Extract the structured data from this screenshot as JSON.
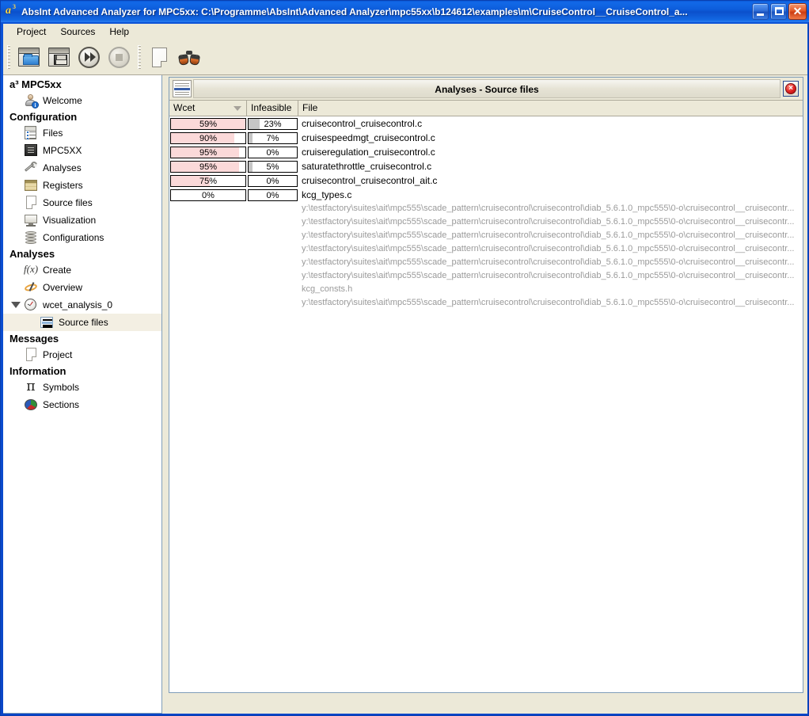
{
  "window": {
    "title": "AbsInt Advanced Analyzer for MPC5xx: C:\\Programme\\AbsInt\\Advanced Analyzer\\mpc55xx\\b124612\\examples\\m\\CruiseControl__CruiseControl_a...",
    "logo_letter": "a",
    "logo_sup": "3",
    "minimize_label": "",
    "maximize_label": "",
    "close_label": "✕"
  },
  "menubar": {
    "items": [
      {
        "label": "Project",
        "name": "menu-project"
      },
      {
        "label": "Sources",
        "name": "menu-sources"
      },
      {
        "label": "Help",
        "name": "menu-help"
      }
    ]
  },
  "toolbar": {
    "buttons": [
      {
        "name": "open-project-button",
        "icon": "open-project-icon",
        "tooltip": "Open project"
      },
      {
        "name": "save-project-button",
        "icon": "save-project-icon",
        "tooltip": "Save project"
      },
      {
        "name": "run-analysis-button",
        "icon": "fast-forward-icon",
        "tooltip": "Run analysis"
      },
      {
        "name": "stop-analysis-button",
        "icon": "stop-icon",
        "tooltip": "Stop analysis"
      },
      {
        "name": "new-file-button",
        "icon": "page-icon",
        "tooltip": "New file"
      },
      {
        "name": "find-button",
        "icon": "binoculars-icon",
        "tooltip": "Find"
      }
    ]
  },
  "sidebar": {
    "root_label": "a³ MPC5xx",
    "sections": [
      {
        "header": null,
        "items": [
          {
            "label": "Welcome",
            "icon": "user-info-icon",
            "name": "sidebar-item-welcome",
            "selected": false
          }
        ]
      },
      {
        "header": "Configuration",
        "items": [
          {
            "label": "Files",
            "icon": "files-icon",
            "name": "sidebar-item-files",
            "selected": false
          },
          {
            "label": "MPC5XX",
            "icon": "chip-icon",
            "name": "sidebar-item-mpc5xx",
            "selected": false
          },
          {
            "label": "Analyses",
            "icon": "wrench-icon",
            "name": "sidebar-item-analyses-config",
            "selected": false
          },
          {
            "label": "Registers",
            "icon": "registers-icon",
            "name": "sidebar-item-registers",
            "selected": false
          },
          {
            "label": "Source files",
            "icon": "document-icon",
            "name": "sidebar-item-source-files-config",
            "selected": false
          },
          {
            "label": "Visualization",
            "icon": "monitor-icon",
            "name": "sidebar-item-visualization",
            "selected": false
          },
          {
            "label": "Configurations",
            "icon": "database-icon",
            "name": "sidebar-item-configurations",
            "selected": false
          }
        ]
      },
      {
        "header": "Analyses",
        "items": [
          {
            "label": "Create",
            "icon": "fx-icon",
            "name": "sidebar-item-create",
            "selected": false
          },
          {
            "label": "Overview",
            "icon": "overview-icon",
            "name": "sidebar-item-overview",
            "selected": false
          },
          {
            "label": "wcet_analysis_0",
            "icon": "stopwatch-icon",
            "name": "sidebar-item-wcet-analysis-0",
            "selected": false,
            "expanded": true
          },
          {
            "label": "Source files",
            "icon": "list-icon",
            "name": "sidebar-item-source-files-analysis",
            "selected": true,
            "level": 2
          }
        ]
      },
      {
        "header": "Messages",
        "items": [
          {
            "label": "Project",
            "icon": "document-icon",
            "name": "sidebar-item-project-messages",
            "selected": false
          }
        ]
      },
      {
        "header": "Information",
        "items": [
          {
            "label": "Symbols",
            "icon": "pi-icon",
            "name": "sidebar-item-symbols",
            "selected": false
          },
          {
            "label": "Sections",
            "icon": "pie-chart-icon",
            "name": "sidebar-item-sections",
            "selected": false
          }
        ]
      }
    ]
  },
  "panel": {
    "title": "Analyses - Source files",
    "close_glyph": "×"
  },
  "table": {
    "columns": [
      {
        "key": "wcet",
        "label": "Wcet",
        "sorted": "desc"
      },
      {
        "key": "infeasible",
        "label": "Infeasible",
        "sorted": null
      },
      {
        "key": "file",
        "label": "File",
        "sorted": null
      }
    ],
    "rows": [
      {
        "wcet": "59%",
        "wcet_value": 59,
        "wcet_fill": 100,
        "infeasible": "23%",
        "infeasible_value": 23,
        "infeasible_fill": 23,
        "file": "cruisecontrol_cruisecontrol.c"
      },
      {
        "wcet": "90%",
        "wcet_value": 90,
        "wcet_fill": 85,
        "infeasible": "7%",
        "infeasible_value": 7,
        "infeasible_fill": 9,
        "file": "cruisespeedmgt_cruisecontrol.c"
      },
      {
        "wcet": "95%",
        "wcet_value": 95,
        "wcet_fill": 92,
        "infeasible": "0%",
        "infeasible_value": 0,
        "infeasible_fill": 0,
        "file": "cruiseregulation_cruisecontrol.c"
      },
      {
        "wcet": "95%",
        "wcet_value": 95,
        "wcet_fill": 92,
        "infeasible": "5%",
        "infeasible_value": 5,
        "infeasible_fill": 9,
        "file": "saturatethrottle_cruisecontrol.c"
      },
      {
        "wcet": "75%",
        "wcet_value": 75,
        "wcet_fill": 52,
        "infeasible": "0%",
        "infeasible_value": 0,
        "infeasible_fill": 0,
        "file": "cruisecontrol_cruisecontrol_ait.c"
      },
      {
        "wcet": "0%",
        "wcet_value": 0,
        "wcet_fill": 0,
        "infeasible": "0%",
        "infeasible_value": 0,
        "infeasible_fill": 0,
        "file": "kcg_types.c"
      }
    ],
    "path_rows": [
      "y:\\testfactory\\suites\\ait\\mpc555\\scade_pattern\\cruisecontrol\\cruisecontrol\\diab_5.6.1.0_mpc555\\0-o\\cruisecontrol__cruisecontr...",
      "y:\\testfactory\\suites\\ait\\mpc555\\scade_pattern\\cruisecontrol\\cruisecontrol\\diab_5.6.1.0_mpc555\\0-o\\cruisecontrol__cruisecontr...",
      "y:\\testfactory\\suites\\ait\\mpc555\\scade_pattern\\cruisecontrol\\cruisecontrol\\diab_5.6.1.0_mpc555\\0-o\\cruisecontrol__cruisecontr...",
      "y:\\testfactory\\suites\\ait\\mpc555\\scade_pattern\\cruisecontrol\\cruisecontrol\\diab_5.6.1.0_mpc555\\0-o\\cruisecontrol__cruisecontr...",
      "y:\\testfactory\\suites\\ait\\mpc555\\scade_pattern\\cruisecontrol\\cruisecontrol\\diab_5.6.1.0_mpc555\\0-o\\cruisecontrol__cruisecontr...",
      "y:\\testfactory\\suites\\ait\\mpc555\\scade_pattern\\cruisecontrol\\cruisecontrol\\diab_5.6.1.0_mpc555\\0-o\\cruisecontrol__cruisecontr...",
      "kcg_consts.h",
      "y:\\testfactory\\suites\\ait\\mpc555\\scade_pattern\\cruisecontrol\\cruisecontrol\\diab_5.6.1.0_mpc555\\0-o\\cruisecontrol__cruisecontr..."
    ]
  },
  "colors": {
    "title_blue": "#0b53d6",
    "chrome": "#ece9d8",
    "wcet_bar": "#fbd9d9",
    "infeasible_bar": "#c6c6c6",
    "selection": "#f3efe3",
    "path_text": "#9a9a9a"
  }
}
